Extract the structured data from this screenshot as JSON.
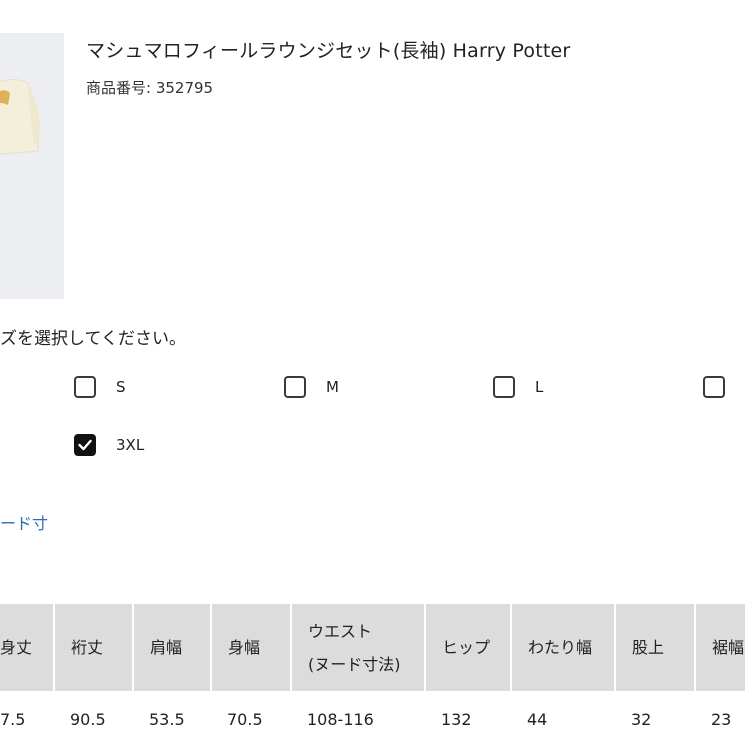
{
  "product": {
    "title": "マシュマロフィールラウンジセット(長袖) Harry Potter",
    "code_label": "商品番号: 352795",
    "image_alt": "cream-sweatshirt-image"
  },
  "size_select": {
    "instruction": "ズを選択してください。",
    "options": [
      {
        "label": "S",
        "checked": false
      },
      {
        "label": "M",
        "checked": false
      },
      {
        "label": "L",
        "checked": false
      },
      {
        "label": "",
        "checked": false
      },
      {
        "label": "3XL",
        "checked": true
      }
    ]
  },
  "nude_link": "ード寸",
  "size_table": {
    "headers": [
      "身丈",
      "裄丈",
      "肩幅",
      "身幅",
      "ウエスト\n(ヌード寸法)",
      "ヒップ",
      "わたり幅",
      "股上",
      "裾幅"
    ],
    "row": [
      "7.5",
      "90.5",
      "53.5",
      "70.5",
      "108-116",
      "132",
      "44",
      "32",
      "23"
    ]
  },
  "colors": {
    "header_bg": "#dcdcdc",
    "link": "#2a6db0",
    "checkbox_checked": "#111111",
    "image_bg": "#eceef1",
    "garment": "#f4efda"
  }
}
